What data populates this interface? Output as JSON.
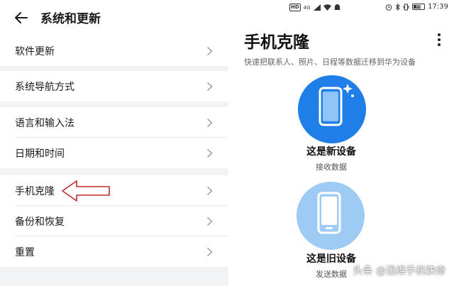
{
  "left": {
    "title": "系统和更新",
    "groups": [
      {
        "items": [
          {
            "label": "软件更新"
          }
        ]
      },
      {
        "items": [
          {
            "label": "系统导航方式"
          }
        ]
      },
      {
        "items": [
          {
            "label": "语言和输入法"
          },
          {
            "label": "日期和时间"
          }
        ]
      },
      {
        "items": [
          {
            "label": "手机克隆"
          },
          {
            "label": "备份和恢复"
          },
          {
            "label": "重置"
          }
        ]
      }
    ]
  },
  "right": {
    "status": {
      "left_badges": [
        "HD",
        "4G"
      ],
      "battery": "66",
      "time": "17:39"
    },
    "title": "手机克隆",
    "subtitle": "快速把联系人、照片、日程等数据迁移到华为设备",
    "options": [
      {
        "title": "这是新设备",
        "subtitle": "接收数据"
      },
      {
        "title": "这是旧设备",
        "subtitle": "发送数据"
      }
    ]
  },
  "watermark": "头条 @迅维手机快修",
  "colors": {
    "accent_blue": "#1f7ee8",
    "light_blue": "#9ecbf4",
    "annotation_red": "#c0282a",
    "panel_bg": "#f1f3f5"
  },
  "icons": [
    "back-arrow-icon",
    "chevron-right-icon",
    "more-vertical-icon",
    "phone-sparkle-icon",
    "phone-icon",
    "wifi-icon",
    "alarm-icon",
    "bluetooth-icon",
    "vibrate-icon",
    "battery-icon",
    "signal-icon"
  ]
}
